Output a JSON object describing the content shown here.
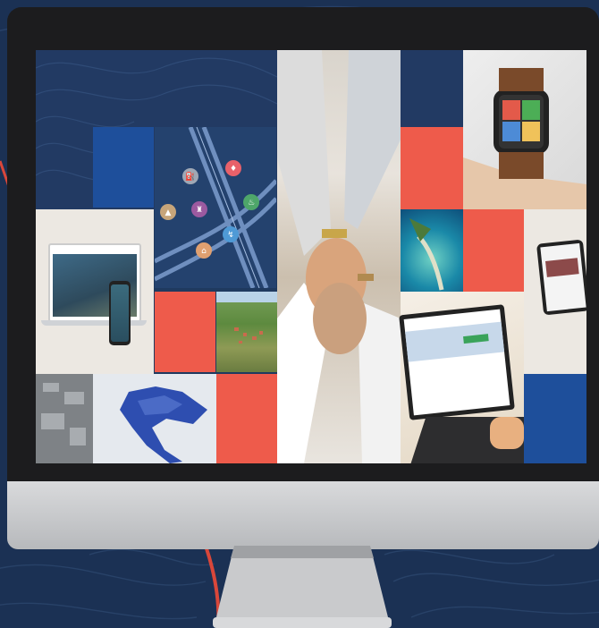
{
  "scene": {
    "description_icons": [
      "oil-pump-icon",
      "fuel-drop-icon",
      "tower-icon",
      "flame-icon",
      "building-icon",
      "plug-icon",
      "factory-icon"
    ],
    "colors": {
      "background": "#1b3154",
      "accent_red": "#ee5b4b",
      "accent_blue": "#1e4f9b",
      "cream": "#ece8e2",
      "bezel": "#1c1c1e",
      "chin": "#c9cacc"
    }
  }
}
